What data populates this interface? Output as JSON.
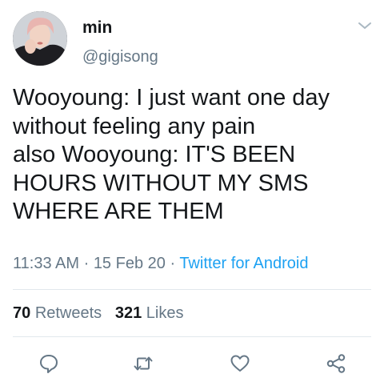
{
  "user": {
    "display_name": "min",
    "handle": "@gigisong"
  },
  "tweet": {
    "text": "Wooyoung: I just want one day\nwithout feeling any pain\nalso Wooyoung: IT'S BEEN\nHOURS WITHOUT MY SMS\nWHERE ARE THEM",
    "time": "11:33 AM",
    "separator": " · ",
    "date": "15 Feb 20",
    "source": "Twitter for Android"
  },
  "stats": {
    "retweets_count": "70",
    "retweets_label": "Retweets",
    "likes_count": "321",
    "likes_label": "Likes"
  },
  "icons": {
    "menu": "chevron-down-icon",
    "reply": "reply-icon",
    "retweet": "retweet-icon",
    "like": "heart-icon",
    "share": "share-icon"
  },
  "colors": {
    "text": "#14171a",
    "secondary": "#657786",
    "link": "#1da1f2",
    "divider": "#e1e8ed"
  }
}
